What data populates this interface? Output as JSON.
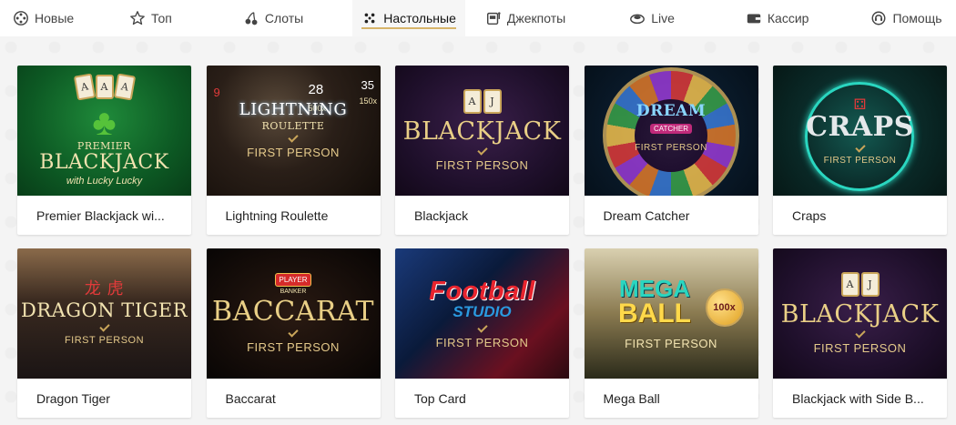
{
  "nav": {
    "items": [
      {
        "label": "Новые",
        "icon": "new-icon"
      },
      {
        "label": "Топ",
        "icon": "star-icon"
      },
      {
        "label": "Слоты",
        "icon": "cherries-icon"
      },
      {
        "label": "Настольные",
        "icon": "dice-icon",
        "active": true
      },
      {
        "label": "Джекпоты",
        "icon": "slot-machine-icon"
      },
      {
        "label": "Live",
        "icon": "live-icon"
      },
      {
        "label": "Кассир",
        "icon": "wallet-icon"
      },
      {
        "label": "Помощь",
        "icon": "support-icon"
      }
    ]
  },
  "colors": {
    "accent": "#d7b46a",
    "page_bg": "#f4f4f4"
  },
  "games": [
    {
      "title": "Premier Blackjack wi...",
      "art": {
        "line1": "PREMIER",
        "line2": "BLACKJACK",
        "line3": "with Lucky Lucky"
      }
    },
    {
      "title": "Lightning Roulette",
      "art": {
        "line1": "LIGHTNING",
        "line2": "ROULETTE",
        "line3": "FIRST PERSON",
        "nums": [
          "9",
          "28",
          "35",
          "500x",
          "150x"
        ]
      }
    },
    {
      "title": "Blackjack",
      "art": {
        "line1": "BLACKJACK",
        "line2": "FIRST PERSON",
        "cards": [
          "A",
          "J"
        ]
      }
    },
    {
      "title": "Dream Catcher",
      "art": {
        "line1": "DREAM",
        "line2": "CATCHER",
        "line3": "FIRST PERSON"
      }
    },
    {
      "title": "Craps",
      "art": {
        "line1": "CRAPS",
        "line2": "FIRST PERSON"
      }
    },
    {
      "title": "Dragon Tiger",
      "art": {
        "line0": "龙 虎",
        "line1": "DRAGON TIGER",
        "line2": "FIRST PERSON"
      }
    },
    {
      "title": "Baccarat",
      "art": {
        "line0": "PLAYER",
        "line0b": "BANKER",
        "line1": "BACCARAT",
        "line2": "FIRST PERSON"
      }
    },
    {
      "title": "Top Card",
      "art": {
        "line1": "Football",
        "line2": "STUDIO",
        "line3": "FIRST PERSON"
      }
    },
    {
      "title": "Mega Ball",
      "art": {
        "line1": "MEGA",
        "line2": "BALL",
        "line3": "FIRST PERSON",
        "badge": "100x"
      }
    },
    {
      "title": "Blackjack with Side B...",
      "art": {
        "line1": "BLACKJACK",
        "line2": "FIRST PERSON",
        "cards": [
          "A",
          "J"
        ]
      }
    }
  ]
}
